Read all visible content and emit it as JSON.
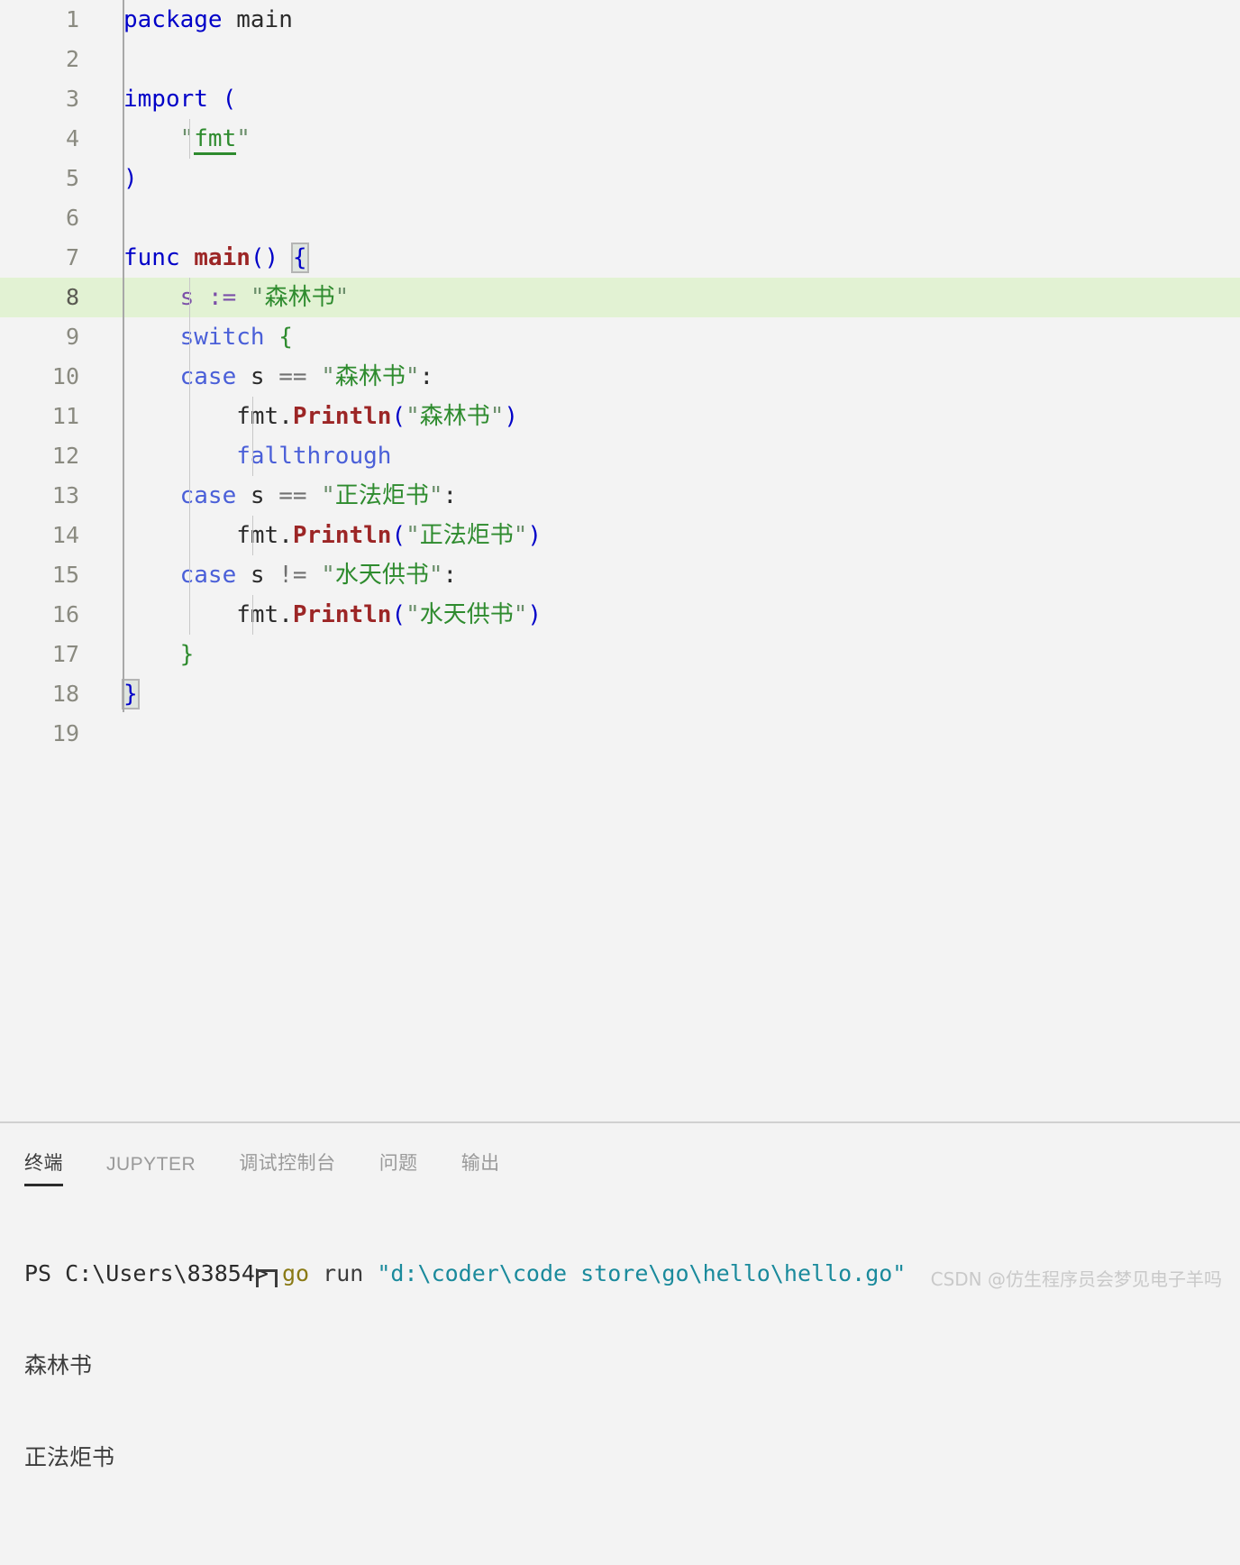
{
  "editor": {
    "language": "go",
    "active_line": 8,
    "lines": [
      {
        "num": "1",
        "text": "package main"
      },
      {
        "num": "2",
        "text": ""
      },
      {
        "num": "3",
        "text": "import ("
      },
      {
        "num": "4",
        "text": "    \"fmt\""
      },
      {
        "num": "5",
        "text": ")"
      },
      {
        "num": "6",
        "text": ""
      },
      {
        "num": "7",
        "text": "func main() {"
      },
      {
        "num": "8",
        "text": "    s := \"森林书\""
      },
      {
        "num": "9",
        "text": "    switch {"
      },
      {
        "num": "10",
        "text": "    case s == \"森林书\":"
      },
      {
        "num": "11",
        "text": "        fmt.Println(\"森林书\")"
      },
      {
        "num": "12",
        "text": "        fallthrough"
      },
      {
        "num": "13",
        "text": "    case s == \"正法炬书\":"
      },
      {
        "num": "14",
        "text": "        fmt.Println(\"正法炬书\")"
      },
      {
        "num": "15",
        "text": "    case s != \"水天供书\":"
      },
      {
        "num": "16",
        "text": "        fmt.Println(\"水天供书\")"
      },
      {
        "num": "17",
        "text": "    }"
      },
      {
        "num": "18",
        "text": "}"
      },
      {
        "num": "19",
        "text": ""
      }
    ],
    "tokens": {
      "package": "package",
      "main_ident": "main",
      "import": "import",
      "lparen": "(",
      "rparen": ")",
      "quote": "\"",
      "fmt": "fmt",
      "func": "func",
      "main_fn": "main",
      "parens": "()",
      "lbrace": "{",
      "rbrace": "}",
      "s": "s",
      "assign": ":=",
      "str_senlin": "森林书",
      "str_zhengfa": "正法炬书",
      "str_shuitian": "水天供书",
      "switch": "switch",
      "case": "case",
      "eq": "==",
      "neq": "!=",
      "colon": ":",
      "fmt_pkg": "fmt",
      "dot": ".",
      "println": "Println",
      "fallthrough": "fallthrough"
    },
    "colors": {
      "background": "#f3f3f3",
      "active_line_highlight": "#e2f2d3",
      "keyword": "#0000c8",
      "control_keyword": "#4a5fd8",
      "function": "#9c2626",
      "string": "#2e8b2e",
      "operator": "#7b4fa8",
      "line_number": "#8a8a80"
    }
  },
  "panel": {
    "tabs": [
      {
        "label": "终端",
        "active": true
      },
      {
        "label": "JUPYTER",
        "active": false
      },
      {
        "label": "调试控制台",
        "active": false
      },
      {
        "label": "问题",
        "active": false
      },
      {
        "label": "输出",
        "active": false
      }
    ],
    "terminal": {
      "prompt": "PS C:\\Users\\83854> ",
      "command": "go",
      "arg": " run ",
      "path": "\"d:\\coder\\code store\\go\\hello\\hello.go\"",
      "output_lines": [
        "森林书",
        "正法炬书"
      ]
    }
  },
  "watermark": {
    "text": "CSDN @仿生程序员会梦见电子羊吗"
  }
}
